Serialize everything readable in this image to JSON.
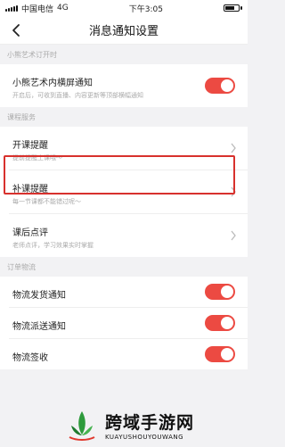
{
  "status_bar": {
    "carrier": "中国电信",
    "network": "4G",
    "time": "下午3:05"
  },
  "header": {
    "title": "消息通知设置"
  },
  "sections": [
    {
      "label": "小熊艺术订开时",
      "rows": [
        {
          "title": "小熊艺术内横屏通知",
          "desc": "开启后，可收到直播、内容更新等顶部横幅通知",
          "control": "toggle",
          "on": true
        }
      ]
    },
    {
      "label": "课程服务",
      "rows": [
        {
          "title": "开课提醒",
          "desc": "提前提醒上课哦～",
          "control": "chevron"
        },
        {
          "title": "补课提醒",
          "desc": "每一节课都不能错过呢～",
          "control": "chevron"
        },
        {
          "title": "课后点评",
          "desc": "老师点评，学习效果实时掌握",
          "control": "chevron"
        }
      ]
    },
    {
      "label": "订单物流",
      "rows": [
        {
          "title": "物流发货通知",
          "control": "toggle",
          "on": true
        },
        {
          "title": "物流派送通知",
          "control": "toggle",
          "on": true
        },
        {
          "title": "物流签收",
          "control": "toggle",
          "on": true
        }
      ]
    }
  ],
  "watermark": {
    "name": "跨域手游网",
    "domain": "KUAYUSHOUYOUWANG"
  },
  "colors": {
    "accent": "#ec4a42",
    "highlight": "#d8312d"
  }
}
